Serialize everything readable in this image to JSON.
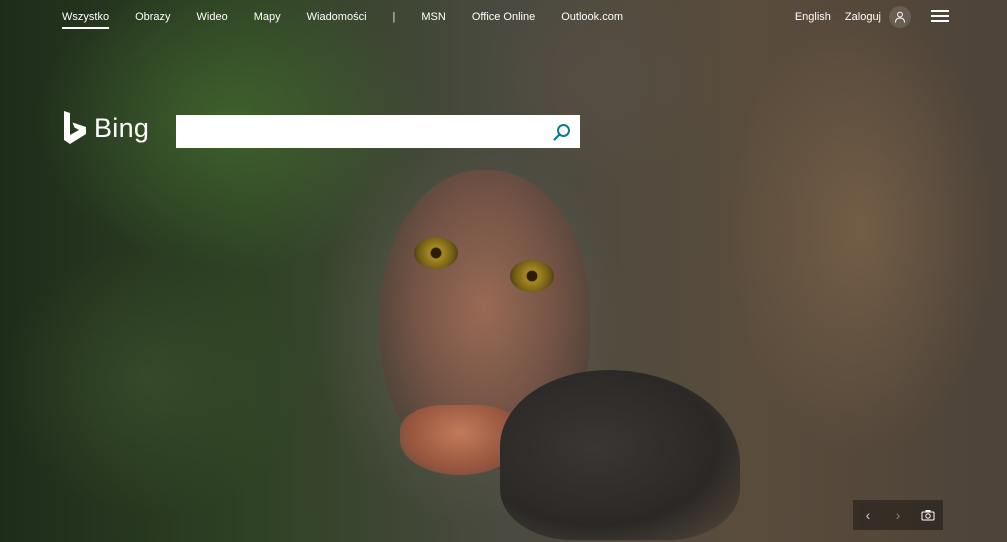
{
  "nav": {
    "items": [
      {
        "label": "Wszystko",
        "active": true
      },
      {
        "label": "Obrazy"
      },
      {
        "label": "Wideo"
      },
      {
        "label": "Mapy"
      },
      {
        "label": "Wiadomości"
      }
    ],
    "separator": "|",
    "extra_items": [
      {
        "label": "MSN"
      },
      {
        "label": "Office Online"
      },
      {
        "label": "Outlook.com"
      }
    ]
  },
  "header_right": {
    "language": "English",
    "signin": "Zaloguj",
    "user_icon": "user-icon",
    "menu_icon": "hamburger-menu-icon"
  },
  "logo": {
    "text": "Bing",
    "icon": "bing-b-logo"
  },
  "search": {
    "value": "",
    "placeholder": "",
    "button_icon": "search-icon"
  },
  "bottom_controls": {
    "prev": "‹",
    "next": "›",
    "camera_icon": "camera-icon"
  },
  "background": {
    "subject": "macaque-monkey-photo"
  }
}
